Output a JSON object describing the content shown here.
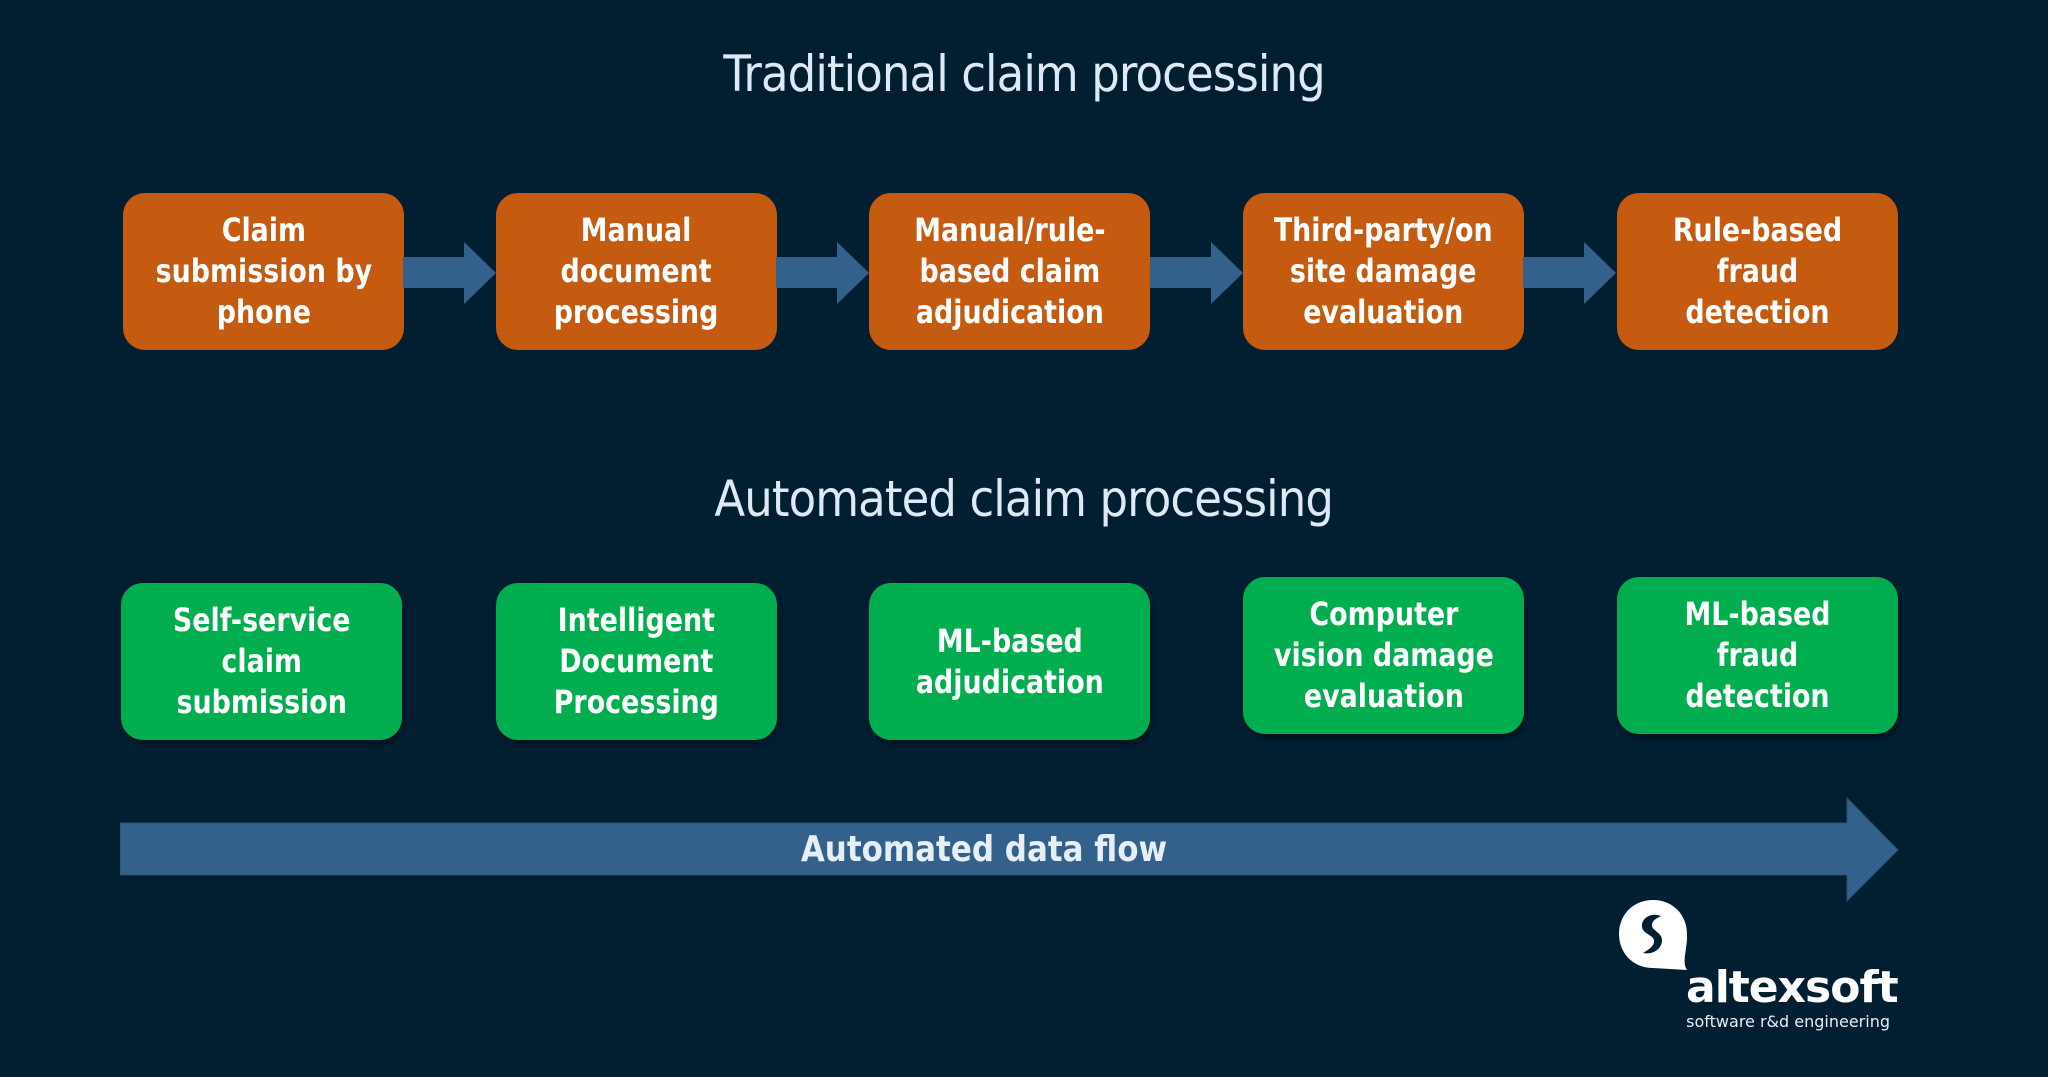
{
  "colors": {
    "background": "#021f32",
    "traditional_box": "#c55a11",
    "automated_box": "#00ae4f",
    "arrow": "#34618c",
    "title_text": "#dde9f5"
  },
  "traditional": {
    "title": "Traditional claim processing",
    "steps": [
      {
        "label": "Claim\nsubmission by\nphone"
      },
      {
        "label": "Manual\ndocument\nprocessing"
      },
      {
        "label": "Manual/rule-\nbased claim\nadjudication"
      },
      {
        "label": "Third-party/on\nsite damage\nevaluation"
      },
      {
        "label": "Rule-based\nfraud detection"
      }
    ],
    "connector_icon": "right-arrow-icon"
  },
  "automated": {
    "title": "Automated claim processing",
    "steps": [
      {
        "label": "Self-service\nclaim\nsubmission"
      },
      {
        "label": "Intelligent\nDocument\nProcessing"
      },
      {
        "label": "ML-based\nadjudication"
      },
      {
        "label": "Computer\nvision damage\nevaluation"
      },
      {
        "label": "ML-based\nfraud detection"
      }
    ]
  },
  "flow": {
    "label": "Automated data flow",
    "icon": "long-right-arrow-icon"
  },
  "logo": {
    "name": "altexsoft",
    "tagline": "software r&d engineering",
    "icon": "altexsoft-logo-icon"
  }
}
